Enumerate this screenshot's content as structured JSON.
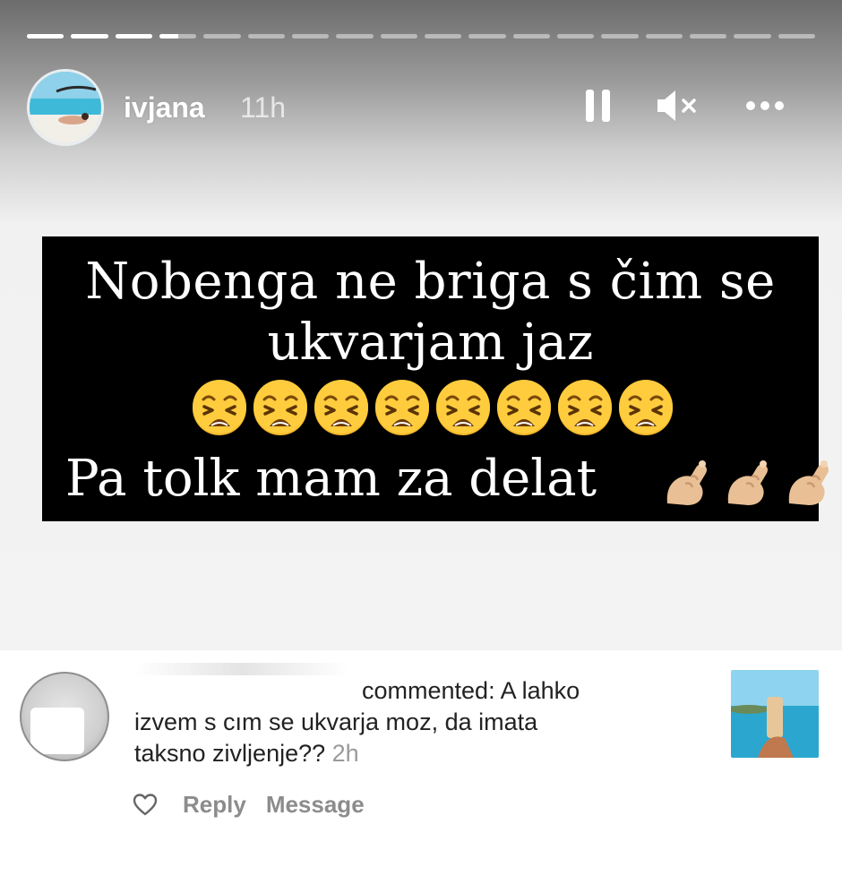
{
  "story": {
    "progress": {
      "segments_total": 18,
      "segments_done": 3,
      "current_fill_fraction": 0.5
    },
    "header": {
      "username": "ivjana",
      "time_ago": "11h",
      "pause_icon": "pause-icon",
      "mute_icon": "speaker-muted-icon",
      "more_icon": "more-dots-icon"
    },
    "text_card": {
      "line1": "Nobenga ne briga s čim se",
      "line2": "ukvarjam jaz",
      "emoji_count": 8,
      "emoji_icon": "weary-face-emoji",
      "line4": "Pa tolk mam za delat",
      "hand_count": 3,
      "hand_icon": "pinched-fingers-emoji"
    },
    "colors": {
      "card_bg": "#000000",
      "card_text": "#ffffff",
      "emoji_face": "#f4b528"
    }
  },
  "comment": {
    "text_line1": "commented: A lahko",
    "text_line2": "izvem s cım se ukvarja moz, da imata",
    "text_line3": "taksno zivljenje??",
    "time_ago": "2h",
    "actions": {
      "like_icon": "heart-icon",
      "reply": "Reply",
      "message": "Message"
    }
  }
}
